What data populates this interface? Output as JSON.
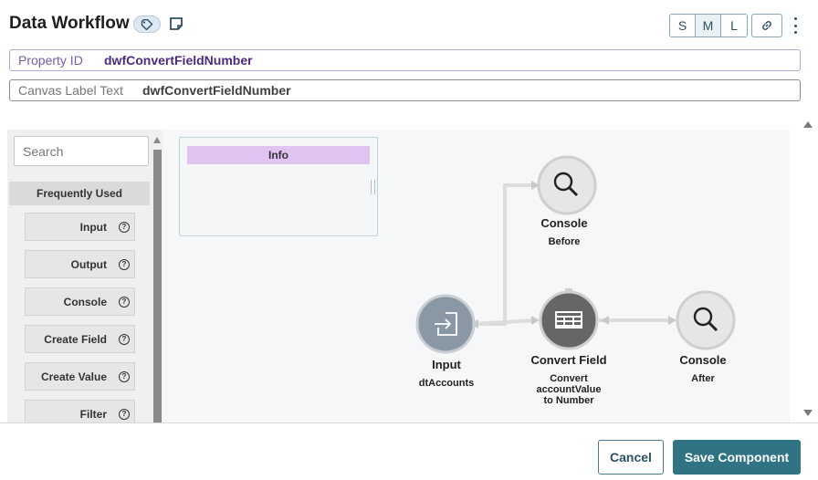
{
  "header": {
    "title": "Data Workflow",
    "size_options": [
      "S",
      "M",
      "L"
    ],
    "selected_size": "M"
  },
  "fields": {
    "property_id": {
      "label": "Property ID",
      "value": "dwfConvertFieldNumber"
    },
    "canvas_label": {
      "label": "Canvas Label Text",
      "value": "dwfConvertFieldNumber"
    }
  },
  "palette": {
    "search_placeholder": "Search",
    "group_title": "Frequently Used",
    "help_glyph": "?",
    "items": [
      "Input",
      "Output",
      "Console",
      "Create Field",
      "Create Value",
      "Filter"
    ]
  },
  "info_panel": {
    "title": "Info"
  },
  "nodes": {
    "console_before": {
      "title": "Console",
      "subtitle": "Before",
      "icon": "magnifier-icon"
    },
    "input": {
      "title": "Input",
      "subtitle": "dtAccounts",
      "icon": "import-icon"
    },
    "convert_field": {
      "title": "Convert Field",
      "subtitle_lines": [
        "Convert",
        "accountValue",
        "to Number"
      ],
      "icon": "table-icon"
    },
    "console_after": {
      "title": "Console",
      "subtitle": "After",
      "icon": "magnifier-icon"
    }
  },
  "footer": {
    "cancel_label": "Cancel",
    "save_label": "Save Component"
  },
  "colors": {
    "accent": "#2f7385",
    "property_text": "#4d2a80",
    "info_header": "#e1c3f2",
    "node_input": "#8a98a5",
    "node_convert": "#666666",
    "node_console": "#e6e6e6"
  }
}
